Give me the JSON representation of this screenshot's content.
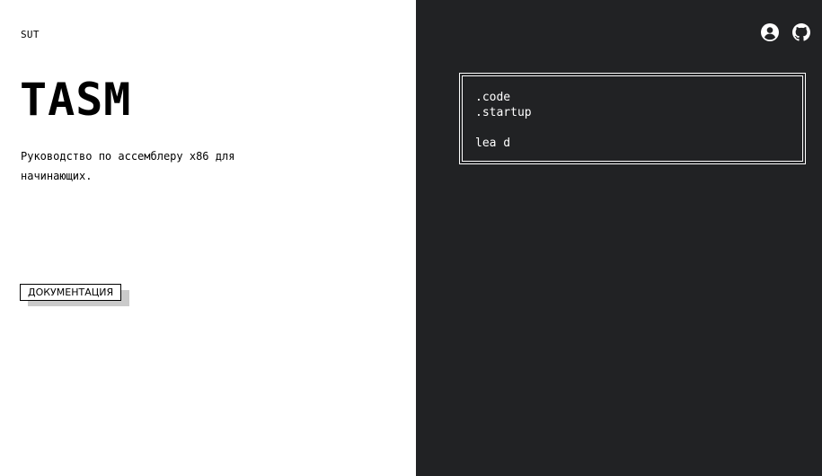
{
  "left": {
    "brand": "SUT",
    "title": "TASM",
    "subtitle": "Руководство по ассемблеру x86 для начинающих.",
    "doc_button": "ДОКУМЕНТАЦИЯ"
  },
  "right": {
    "icons": [
      "account-icon",
      "github-icon"
    ],
    "code_lines": [
      ".code",
      ".startup",
      "",
      "lea d"
    ]
  },
  "colors": {
    "left_bg": "#ffffff",
    "right_bg": "#212224",
    "text_dark": "#000000",
    "text_light": "#ffffff"
  }
}
